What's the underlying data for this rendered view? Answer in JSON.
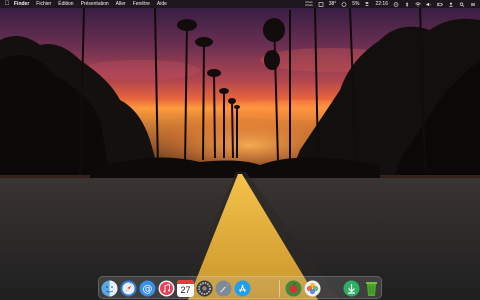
{
  "menubar": {
    "apple_icon": "apple-logo-icon",
    "app_name": "Finder",
    "menus": [
      "Fichier",
      "Édition",
      "Présentation",
      "Aller",
      "Fenêtre",
      "Aide"
    ],
    "status": {
      "net_up": "0 Ko/s",
      "net_down": "0 Ko/s",
      "temperature": "38°",
      "battery": "5%",
      "time": "22:16"
    }
  },
  "dock": {
    "items": [
      {
        "icon": "finder-icon"
      },
      {
        "icon": "safari-icon"
      },
      {
        "icon": "mail-icon"
      },
      {
        "icon": "music-icon"
      },
      {
        "icon": "calendar-icon",
        "text": "27"
      },
      {
        "icon": "settings-gear-icon"
      },
      {
        "icon": "launchpad-icon"
      },
      {
        "icon": "app-store-icon"
      },
      {
        "icon": "photo-app-icon"
      },
      {
        "icon": "photos-icon"
      },
      {
        "icon": "downloads-icon"
      },
      {
        "icon": "trash-icon"
      }
    ]
  },
  "colors": {
    "sky_top": "#3a1f4a",
    "sky_mid": "#b24a52",
    "sky_glow": "#ff8a3a",
    "road": "#2a2a2a",
    "road_line": "#e2b23b"
  }
}
